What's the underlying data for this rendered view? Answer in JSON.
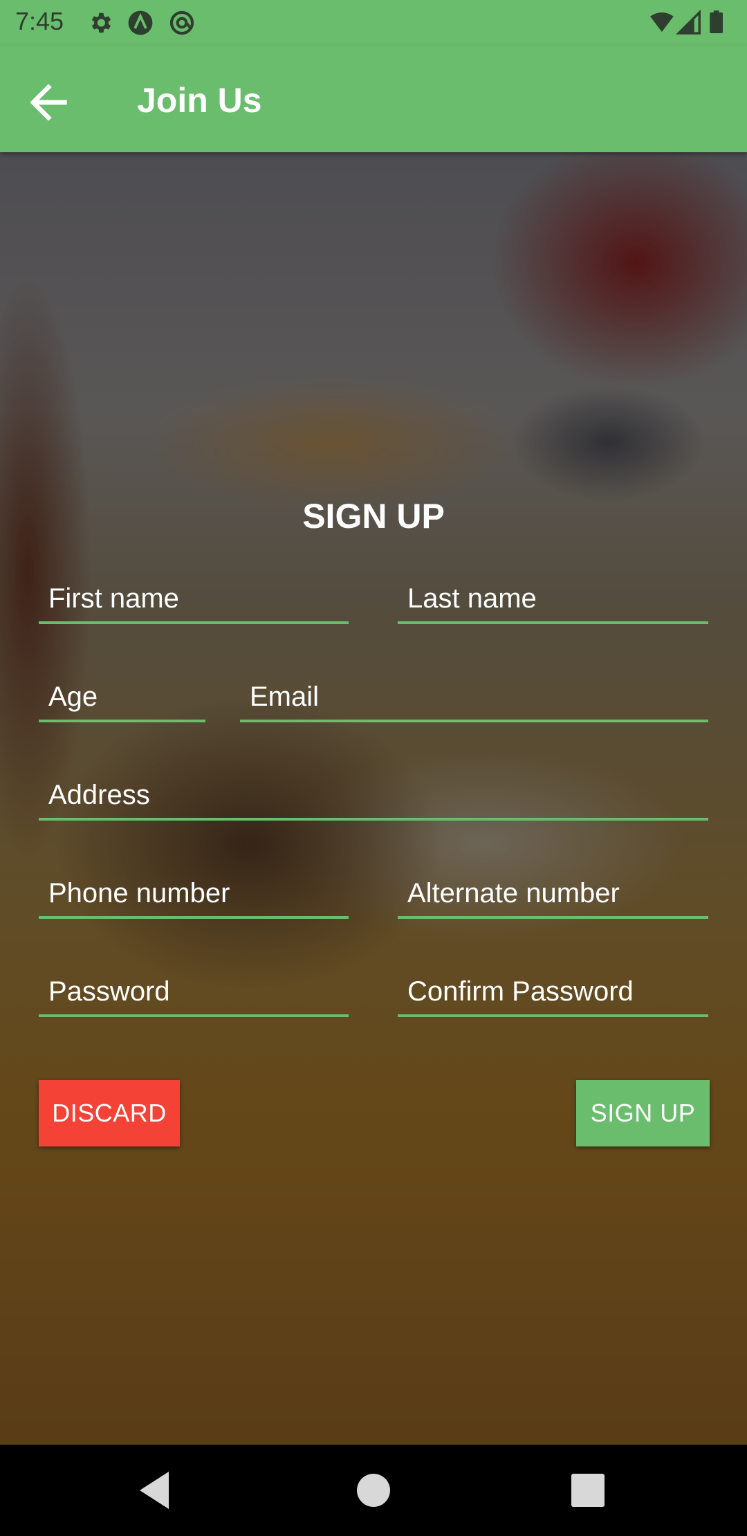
{
  "status_bar": {
    "time": "7:45",
    "icons": [
      "settings-icon",
      "a-circle-icon",
      "at-icon",
      "wifi-icon",
      "signal-icon",
      "battery-icon"
    ]
  },
  "app_bar": {
    "title": "Join Us",
    "back_icon": "arrow-back-icon"
  },
  "form": {
    "title": "SIGN UP",
    "fields": {
      "first_name": "First name",
      "last_name": "Last name",
      "age": "Age",
      "email": "Email",
      "address": "Address",
      "phone": "Phone number",
      "alternate": "Alternate number",
      "password": "Password",
      "confirm_password": "Confirm Password"
    },
    "discard_label": "DISCARD",
    "signup_label": "SIGN UP"
  },
  "colors": {
    "accent": "#6abd6c",
    "discard": "#f44236"
  },
  "nav_bar": {
    "icons": [
      "back-triangle-icon",
      "home-circle-icon",
      "recents-square-icon"
    ]
  }
}
